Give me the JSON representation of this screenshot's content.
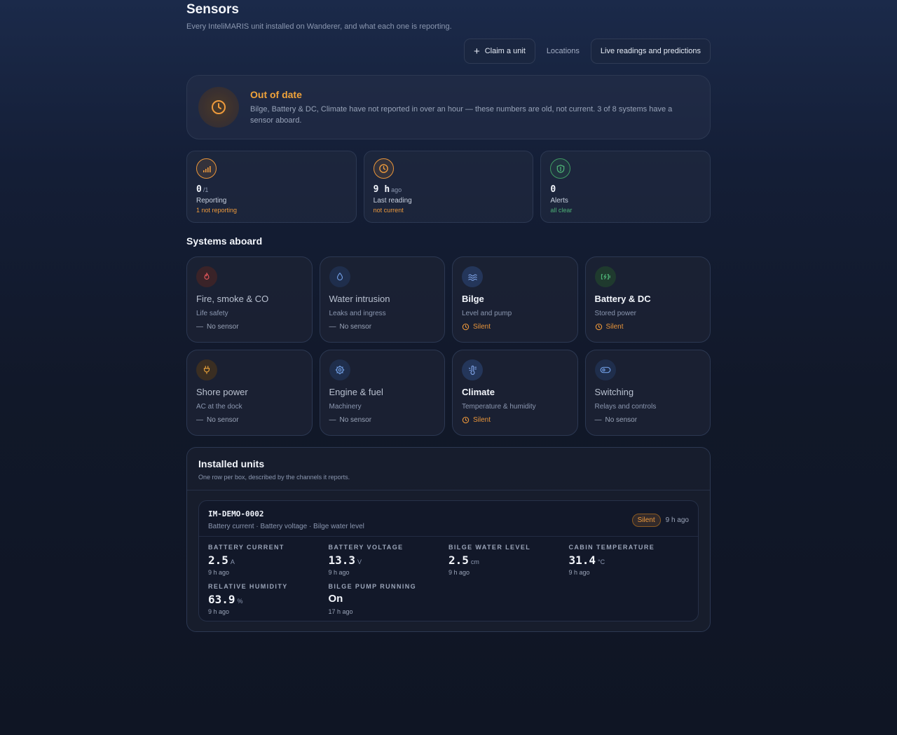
{
  "header": {
    "title": "Sensors",
    "subtitle": "Every InteliMARIS unit installed on Wanderer, and what each one is reporting."
  },
  "actions": {
    "claim": "Claim a unit",
    "locations": "Locations",
    "live": "Live readings and predictions"
  },
  "alert": {
    "title": "Out of date",
    "body": "Bilge, Battery & DC, Climate have not reported in over an hour — these numbers are old, not current. 3 of 8 systems have a sensor aboard."
  },
  "stats": [
    {
      "value": "0",
      "unit": "/1",
      "label": "Reporting",
      "note": "1 not reporting",
      "icon": "signal-icon"
    },
    {
      "value": "9 h",
      "unit": "ago",
      "label": "Last reading",
      "note": "not current",
      "icon": "clock-icon"
    },
    {
      "value": "0",
      "unit": "",
      "label": "Alerts",
      "note": "all clear",
      "icon": "shield-icon"
    }
  ],
  "systems_title": "Systems aboard",
  "systems": [
    {
      "name": "Fire, smoke & CO",
      "desc": "Life safety",
      "status": "No sensor",
      "icon": "flame-icon"
    },
    {
      "name": "Water intrusion",
      "desc": "Leaks and ingress",
      "status": "No sensor",
      "icon": "droplet-icon"
    },
    {
      "name": "Bilge",
      "desc": "Level and pump",
      "status": "Silent",
      "icon": "waves-icon"
    },
    {
      "name": "Battery & DC",
      "desc": "Stored power",
      "status": "Silent",
      "icon": "battery-icon"
    },
    {
      "name": "Shore power",
      "desc": "AC at the dock",
      "status": "No sensor",
      "icon": "plug-icon"
    },
    {
      "name": "Engine & fuel",
      "desc": "Machinery",
      "status": "No sensor",
      "icon": "engine-icon"
    },
    {
      "name": "Climate",
      "desc": "Temperature & humidity",
      "status": "Silent",
      "icon": "thermometer-icon"
    },
    {
      "name": "Switching",
      "desc": "Relays and controls",
      "status": "No sensor",
      "icon": "toggle-icon"
    }
  ],
  "units": {
    "title": "Installed units",
    "subtitle": "One row per box, described by the channels it reports.",
    "unit": {
      "id": "IM-DEMO-0002",
      "channels": "Battery current · Battery voltage · Bilge water level",
      "badge": "Silent",
      "ago": "9 h ago",
      "readings": [
        {
          "label": "BATTERY CURRENT",
          "value": "2.5",
          "unit": "A",
          "ago": "9 h ago"
        },
        {
          "label": "BATTERY VOLTAGE",
          "value": "13.3",
          "unit": "V",
          "ago": "9 h ago"
        },
        {
          "label": "BILGE WATER LEVEL",
          "value": "2.5",
          "unit": "cm",
          "ago": "9 h ago"
        },
        {
          "label": "CABIN TEMPERATURE",
          "value": "31.4",
          "unit": "°C",
          "ago": "9 h ago"
        },
        {
          "label": "RELATIVE HUMIDITY",
          "value": "63.9",
          "unit": "%",
          "ago": "9 h ago"
        },
        {
          "label": "BILGE PUMP RUNNING",
          "value": "On",
          "unit": "",
          "ago": "17 h ago"
        }
      ]
    }
  },
  "colors": {
    "warning": "#ee9a3c",
    "ok": "#4db176",
    "accent_blue": "#3b5a9a"
  }
}
